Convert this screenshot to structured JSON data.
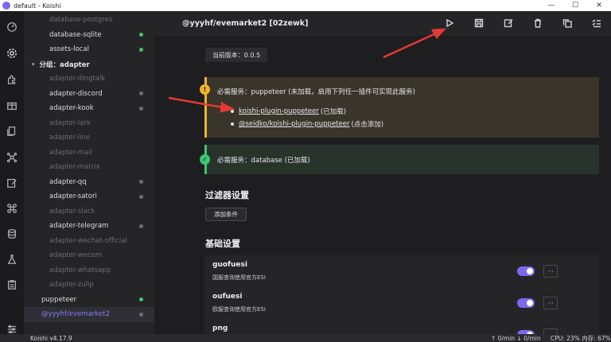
{
  "window": {
    "title": "default - Koishi",
    "min": "—",
    "max": "☐",
    "close": "✕"
  },
  "sidebar": {
    "items": [
      {
        "label": "database-postgres",
        "status": "none",
        "dim": true
      },
      {
        "label": "database-sqlite",
        "status": "green",
        "dim": false
      },
      {
        "label": "assets-local",
        "status": "green",
        "dim": false
      },
      {
        "label": "分组：adapter",
        "group": true
      },
      {
        "label": "adapter-dingtalk",
        "status": "none",
        "dim": true
      },
      {
        "label": "adapter-discord",
        "status": "gray",
        "dim": false
      },
      {
        "label": "adapter-kook",
        "status": "gray",
        "dim": false
      },
      {
        "label": "adapter-lark",
        "status": "none",
        "dim": true
      },
      {
        "label": "adapter-line",
        "status": "none",
        "dim": true
      },
      {
        "label": "adapter-mail",
        "status": "none",
        "dim": true
      },
      {
        "label": "adapter-matrix",
        "status": "none",
        "dim": true
      },
      {
        "label": "adapter-qq",
        "status": "gray",
        "dim": false
      },
      {
        "label": "adapter-satori",
        "status": "gray",
        "dim": false
      },
      {
        "label": "adapter-slack",
        "status": "none",
        "dim": true
      },
      {
        "label": "adapter-telegram",
        "status": "gray",
        "dim": false
      },
      {
        "label": "adapter-wechat-official",
        "status": "none",
        "dim": true
      },
      {
        "label": "adapter-wecom",
        "status": "none",
        "dim": true
      },
      {
        "label": "adapter-whatsapp",
        "status": "none",
        "dim": true
      },
      {
        "label": "adapter-zulip",
        "status": "none",
        "dim": true
      },
      {
        "label": "puppeteer",
        "status": "green",
        "plain": true
      },
      {
        "label": "@yyyhf/evemarket2",
        "status": "gray",
        "selected": true
      }
    ]
  },
  "header": {
    "title": "@yyyhf/evemarket2 [02zewk]"
  },
  "main": {
    "version": "当前版本：0.0.5",
    "warn": {
      "text": "必需服务：puppeteer (未加载，启用下列任一插件可实现此服务)",
      "items": [
        {
          "link": "koishi-plugin-puppeteer",
          "note": "(已加载)"
        },
        {
          "link": "@seidko/koishi-plugin-puppeteer",
          "note": "(点击添加)"
        }
      ]
    },
    "ok": {
      "text": "必需服务：database (已加载)"
    },
    "filter_title": "过滤器设置",
    "add_condition": "添加条件",
    "basic_title": "基础设置",
    "settings": [
      {
        "name": "guofuesi",
        "desc": "国服查询使用官方ESI",
        "enabled": true
      },
      {
        "name": "oufuesi",
        "desc": "欧服查询使用官方ESI",
        "enabled": true
      },
      {
        "name": "png",
        "desc": "",
        "enabled": true
      }
    ],
    "more_label": "···"
  },
  "statusbar": {
    "version": "Koishi v4.17.9",
    "rate": "↑ 0/min  ↓ 0/min",
    "cpu": "CPU: 23% 内存: 67%"
  },
  "colors": {
    "accent": "#7b68ee",
    "ok": "#3dc76f",
    "warn": "#f0b429",
    "arrow": "#e53935"
  }
}
